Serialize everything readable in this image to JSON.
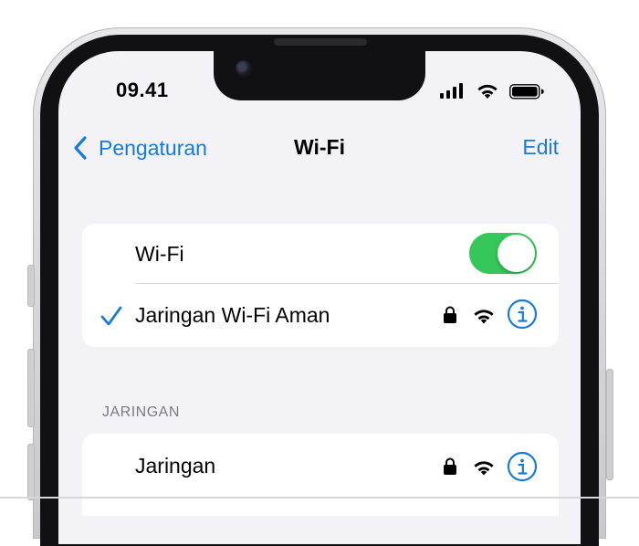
{
  "status_bar": {
    "time": "09.41",
    "icons": [
      "cellular-signal-icon",
      "wifi-signal-icon",
      "battery-icon"
    ]
  },
  "nav": {
    "back_label": "Pengaturan",
    "title": "Wi-Fi",
    "edit_label": "Edit"
  },
  "wifi_group": {
    "toggle_label": "Wi-Fi",
    "toggle_on": true,
    "connected_network": "Jaringan Wi-Fi Aman"
  },
  "networks_section": {
    "header": "JARINGAN",
    "items": [
      {
        "name": "Jaringan"
      }
    ]
  },
  "colors": {
    "accent": "#1a7ad9",
    "toggle_on": "#35c759",
    "background": "#f2f2f7"
  }
}
